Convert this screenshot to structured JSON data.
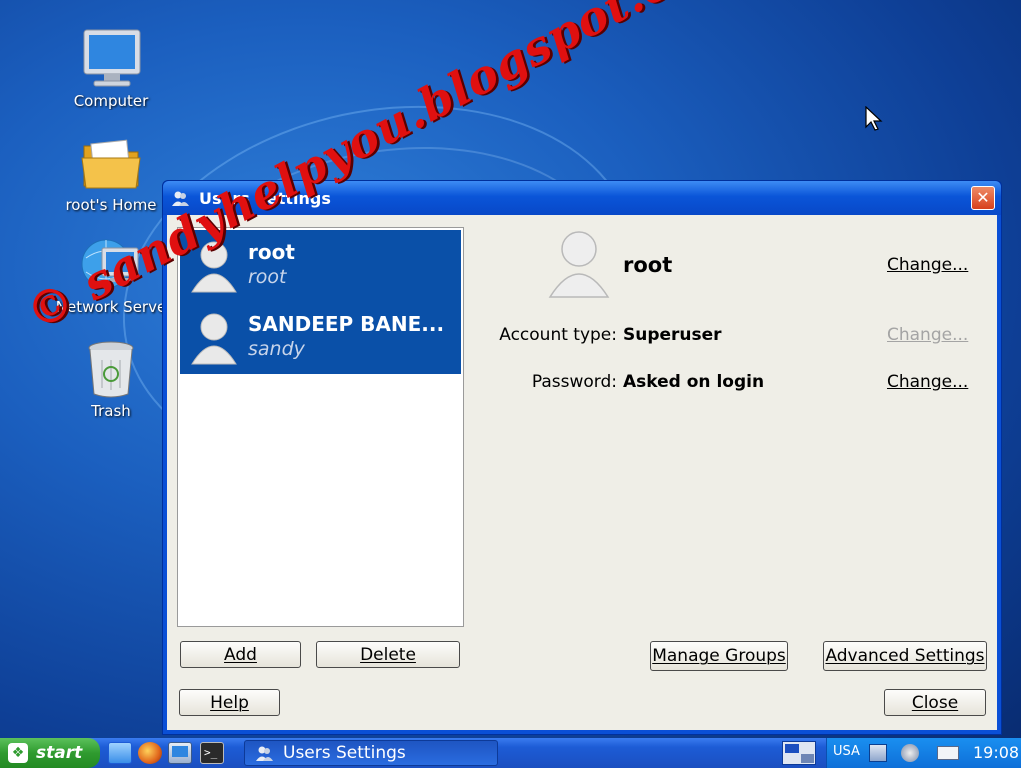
{
  "desktop": {
    "icons": [
      {
        "label": "Computer",
        "icon": "computer-icon"
      },
      {
        "label": "root's Home",
        "icon": "home-folder-icon"
      },
      {
        "label": "Network Serve",
        "icon": "network-server-icon"
      },
      {
        "label": "Trash",
        "icon": "trash-icon"
      }
    ]
  },
  "window": {
    "title": "Users Settings",
    "close_label": "✕",
    "users": [
      {
        "name": "root",
        "login": "root"
      },
      {
        "name": "SANDEEP BANE...",
        "login": "sandy"
      }
    ],
    "selected": {
      "name": "root",
      "change_name": "Change...",
      "account_type_label": "Account type:",
      "account_type_value": "Superuser",
      "account_type_change": "Change...",
      "password_label": "Password:",
      "password_value": "Asked on login",
      "password_change": "Change..."
    },
    "buttons": {
      "add": "Add",
      "delete": "Delete",
      "manage_groups": "Manage Groups",
      "advanced_settings": "Advanced Settings",
      "help": "Help",
      "close": "Close"
    }
  },
  "taskbar": {
    "start_label": "start",
    "task_label": "Users Settings",
    "keyboard_layout": "USA",
    "clock": "19:08"
  },
  "watermark": "© sandyhelpyou.blogspot.com ®",
  "colors": {
    "selection": "#0a50a8",
    "titlebar": "#0a55d8",
    "close_button": "#d7401c",
    "start_button": "#2f9b2f",
    "watermark": "#e01010"
  }
}
